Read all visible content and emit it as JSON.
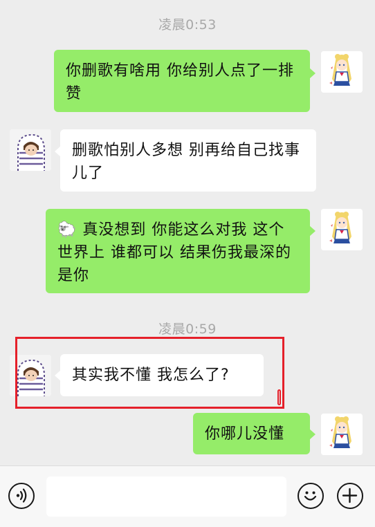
{
  "timestamps": [
    "凌晨0:53",
    "凌晨0:59"
  ],
  "messages": [
    {
      "side": "right",
      "text": "你删歌有啥用 你给别人点了一排赞"
    },
    {
      "side": "left",
      "text": "删歌怕别人多想 别再给自己找事儿了"
    },
    {
      "side": "right",
      "emoji": "🐑",
      "text": " 真没想到 你能这么对我 这个世界上 谁都可以 结果伤我最深的是你"
    },
    {
      "side": "left",
      "text": "其实我不懂 我怎么了?"
    },
    {
      "side": "right",
      "text": "你哪儿没懂"
    }
  ],
  "input": {
    "placeholder": ""
  },
  "icons": {
    "voice": "voice-icon",
    "emoji": "smiley-icon",
    "plus": "plus-icon"
  },
  "colors": {
    "background": "#ededed",
    "sent_bubble": "#95ec69",
    "received_bubble": "#ffffff",
    "timestamp": "#a8a8a8",
    "highlight": "#e5202a"
  }
}
